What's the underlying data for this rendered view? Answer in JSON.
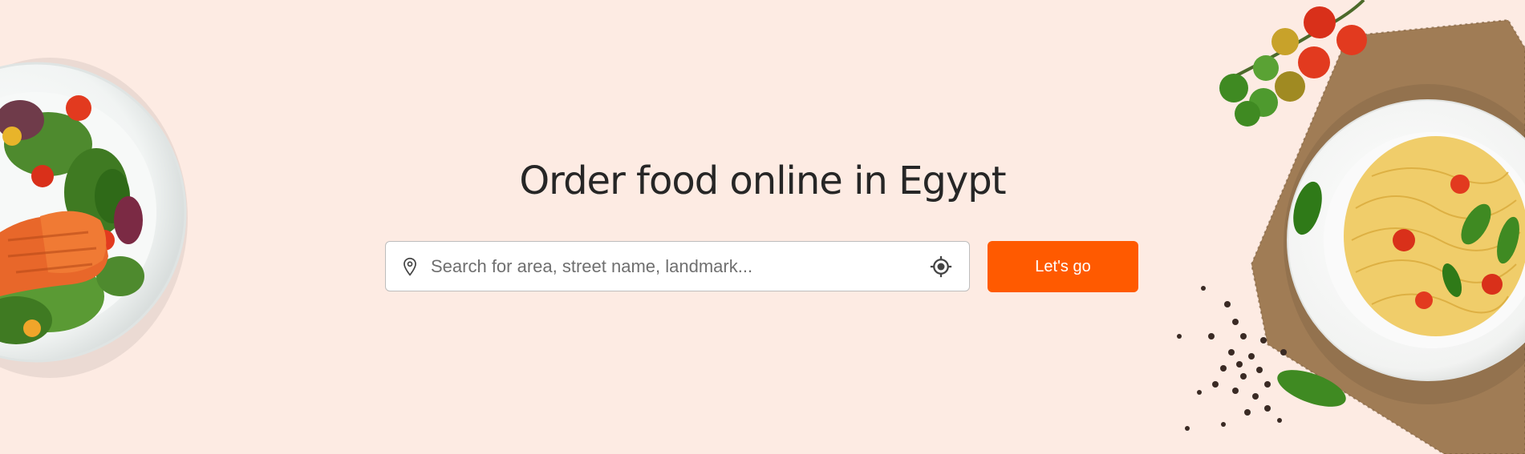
{
  "hero": {
    "title": "Order food online in Egypt",
    "search": {
      "placeholder": "Search for area, street name, landmark...",
      "value": "",
      "leading_icon": "map-pin-icon",
      "trailing_icon": "locate-me-icon"
    },
    "cta_label": "Let's go"
  },
  "colors": {
    "background": "#fdebe3",
    "accent": "#ff5a00",
    "title": "#262626",
    "input_border": "#bdbdbd"
  },
  "decorations": {
    "left_image": "salad-with-salmon-plate",
    "right_image": "spaghetti-plate-with-tomatoes-and-peppercorns"
  }
}
